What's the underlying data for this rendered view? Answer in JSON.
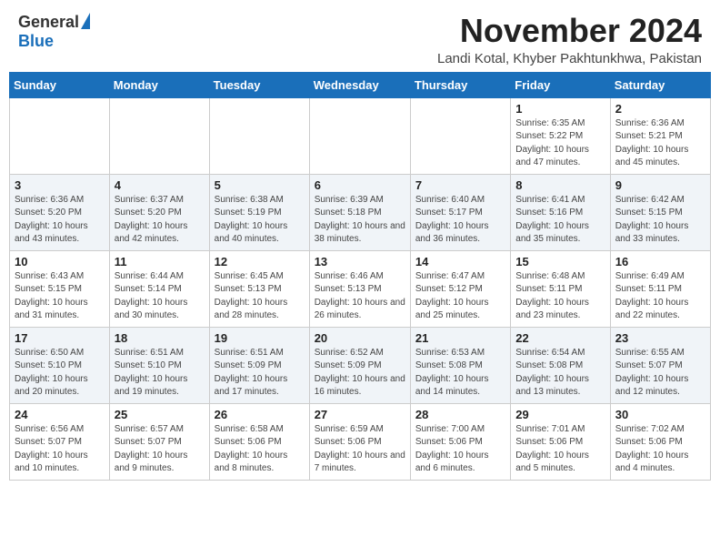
{
  "header": {
    "logo_general": "General",
    "logo_blue": "Blue",
    "month": "November 2024",
    "location": "Landi Kotal, Khyber Pakhtunkhwa, Pakistan"
  },
  "weekdays": [
    "Sunday",
    "Monday",
    "Tuesday",
    "Wednesday",
    "Thursday",
    "Friday",
    "Saturday"
  ],
  "weeks": [
    [
      {
        "day": "",
        "info": ""
      },
      {
        "day": "",
        "info": ""
      },
      {
        "day": "",
        "info": ""
      },
      {
        "day": "",
        "info": ""
      },
      {
        "day": "",
        "info": ""
      },
      {
        "day": "1",
        "info": "Sunrise: 6:35 AM\nSunset: 5:22 PM\nDaylight: 10 hours and 47 minutes."
      },
      {
        "day": "2",
        "info": "Sunrise: 6:36 AM\nSunset: 5:21 PM\nDaylight: 10 hours and 45 minutes."
      }
    ],
    [
      {
        "day": "3",
        "info": "Sunrise: 6:36 AM\nSunset: 5:20 PM\nDaylight: 10 hours and 43 minutes."
      },
      {
        "day": "4",
        "info": "Sunrise: 6:37 AM\nSunset: 5:20 PM\nDaylight: 10 hours and 42 minutes."
      },
      {
        "day": "5",
        "info": "Sunrise: 6:38 AM\nSunset: 5:19 PM\nDaylight: 10 hours and 40 minutes."
      },
      {
        "day": "6",
        "info": "Sunrise: 6:39 AM\nSunset: 5:18 PM\nDaylight: 10 hours and 38 minutes."
      },
      {
        "day": "7",
        "info": "Sunrise: 6:40 AM\nSunset: 5:17 PM\nDaylight: 10 hours and 36 minutes."
      },
      {
        "day": "8",
        "info": "Sunrise: 6:41 AM\nSunset: 5:16 PM\nDaylight: 10 hours and 35 minutes."
      },
      {
        "day": "9",
        "info": "Sunrise: 6:42 AM\nSunset: 5:15 PM\nDaylight: 10 hours and 33 minutes."
      }
    ],
    [
      {
        "day": "10",
        "info": "Sunrise: 6:43 AM\nSunset: 5:15 PM\nDaylight: 10 hours and 31 minutes."
      },
      {
        "day": "11",
        "info": "Sunrise: 6:44 AM\nSunset: 5:14 PM\nDaylight: 10 hours and 30 minutes."
      },
      {
        "day": "12",
        "info": "Sunrise: 6:45 AM\nSunset: 5:13 PM\nDaylight: 10 hours and 28 minutes."
      },
      {
        "day": "13",
        "info": "Sunrise: 6:46 AM\nSunset: 5:13 PM\nDaylight: 10 hours and 26 minutes."
      },
      {
        "day": "14",
        "info": "Sunrise: 6:47 AM\nSunset: 5:12 PM\nDaylight: 10 hours and 25 minutes."
      },
      {
        "day": "15",
        "info": "Sunrise: 6:48 AM\nSunset: 5:11 PM\nDaylight: 10 hours and 23 minutes."
      },
      {
        "day": "16",
        "info": "Sunrise: 6:49 AM\nSunset: 5:11 PM\nDaylight: 10 hours and 22 minutes."
      }
    ],
    [
      {
        "day": "17",
        "info": "Sunrise: 6:50 AM\nSunset: 5:10 PM\nDaylight: 10 hours and 20 minutes."
      },
      {
        "day": "18",
        "info": "Sunrise: 6:51 AM\nSunset: 5:10 PM\nDaylight: 10 hours and 19 minutes."
      },
      {
        "day": "19",
        "info": "Sunrise: 6:51 AM\nSunset: 5:09 PM\nDaylight: 10 hours and 17 minutes."
      },
      {
        "day": "20",
        "info": "Sunrise: 6:52 AM\nSunset: 5:09 PM\nDaylight: 10 hours and 16 minutes."
      },
      {
        "day": "21",
        "info": "Sunrise: 6:53 AM\nSunset: 5:08 PM\nDaylight: 10 hours and 14 minutes."
      },
      {
        "day": "22",
        "info": "Sunrise: 6:54 AM\nSunset: 5:08 PM\nDaylight: 10 hours and 13 minutes."
      },
      {
        "day": "23",
        "info": "Sunrise: 6:55 AM\nSunset: 5:07 PM\nDaylight: 10 hours and 12 minutes."
      }
    ],
    [
      {
        "day": "24",
        "info": "Sunrise: 6:56 AM\nSunset: 5:07 PM\nDaylight: 10 hours and 10 minutes."
      },
      {
        "day": "25",
        "info": "Sunrise: 6:57 AM\nSunset: 5:07 PM\nDaylight: 10 hours and 9 minutes."
      },
      {
        "day": "26",
        "info": "Sunrise: 6:58 AM\nSunset: 5:06 PM\nDaylight: 10 hours and 8 minutes."
      },
      {
        "day": "27",
        "info": "Sunrise: 6:59 AM\nSunset: 5:06 PM\nDaylight: 10 hours and 7 minutes."
      },
      {
        "day": "28",
        "info": "Sunrise: 7:00 AM\nSunset: 5:06 PM\nDaylight: 10 hours and 6 minutes."
      },
      {
        "day": "29",
        "info": "Sunrise: 7:01 AM\nSunset: 5:06 PM\nDaylight: 10 hours and 5 minutes."
      },
      {
        "day": "30",
        "info": "Sunrise: 7:02 AM\nSunset: 5:06 PM\nDaylight: 10 hours and 4 minutes."
      }
    ]
  ]
}
